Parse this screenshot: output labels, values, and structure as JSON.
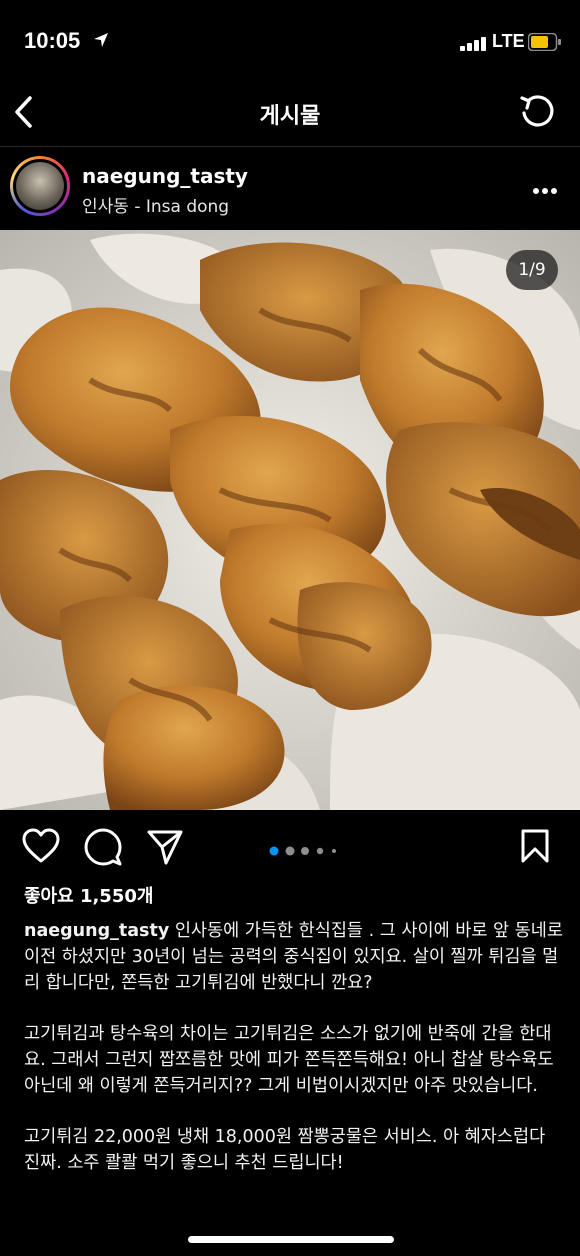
{
  "status_bar": {
    "time": "10:05",
    "network": "LTE",
    "battery_color": "#f5c400"
  },
  "nav": {
    "title": "게시물",
    "back_icon": "chevron-left-icon",
    "refresh_icon": "refresh-icon"
  },
  "post": {
    "username": "naegung_tasty",
    "location": "인사동 - Insa dong",
    "image_counter": "1/9",
    "carousel": {
      "total_dots_visible": 5,
      "active_index": 0
    },
    "likes": "좋아요 1,550개",
    "caption": {
      "user": "naegung_tasty",
      "paragraphs": [
        "인사동에 가득한 한식집들 . 그 사이에 바로 앞 동네로 이전 하셨지만 30년이 넘는 공력의 중식집이 있지요. 살이 찔까 튀김을 멀리 합니다만, 쫀득한 고기튀김에 반했다니 깐요?",
        "고기튀김과 탕수육의 차이는 고기튀김은 소스가 없기에 반죽에 간을 한대요. 그래서 그런지 짭쪼름한 맛에 피가 쫀득쫀득해요! 아니 찹살 탕수육도 아닌데 왜 이렇게 쫀득거리지?? 그게 비법이시겠지만 아주 맛있습니다.",
        "고기튀김 22,000원 냉채 18,000원 짬뽕궁물은 서비스. 아 혜자스럽다 진짜. 소주 콸콸 먹기 좋으니 추천 드립니다!"
      ]
    }
  }
}
